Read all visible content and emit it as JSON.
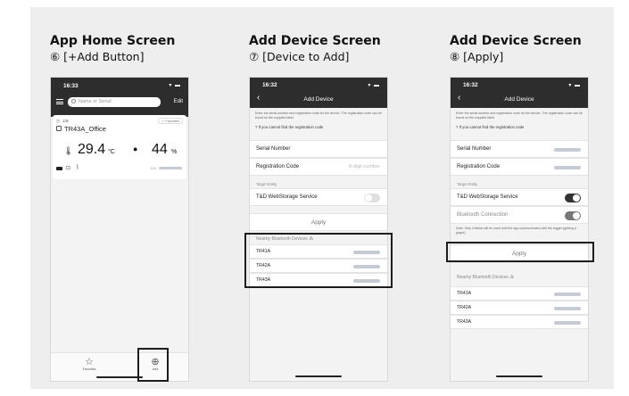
{
  "columns": [
    {
      "title": "App Home Screen",
      "subtitle": "⑥ [+Add Button]"
    },
    {
      "title": "Add Device Screen",
      "subtitle": "⑦ [Device to Add]"
    },
    {
      "title": "Add Device Screen",
      "subtitle": "⑧ [Apply]"
    }
  ],
  "home": {
    "time": "16:33",
    "search_placeholder": "Name or Serial",
    "edit": "Edit",
    "card": {
      "age": "13s",
      "favorites": "Favorites",
      "name": "TR43A_Office",
      "temp_value": "29.4",
      "temp_unit": "°C",
      "hum_value": "44",
      "hum_unit": "%",
      "signal": "12h"
    },
    "tab_favorites": "Favorites",
    "tab_add": "Add"
  },
  "add7": {
    "time": "16:32",
    "title": "Add Device",
    "intro": "Enter the serial number and registration code for the device. The registration code can be found on the supplied label.",
    "help": "If you cannot find the registration code",
    "serial_label": "Serial Number",
    "regcode_label": "Registration Code",
    "regcode_placeholder": "8-digit number",
    "target_section": "Target Entity",
    "webstorage_label": "T&D WebStorage Service",
    "apply": "Apply",
    "nearby_label": "Nearby Bluetooth Devices",
    "devices": [
      "TR41A",
      "TR42A",
      "TR43A"
    ]
  },
  "add8": {
    "time": "16:32",
    "title": "Add Device",
    "intro": "Enter the serial number and registration code for the device. The registration code can be found on the supplied label.",
    "help": "If you cannot find the registration code",
    "serial_label": "Serial Number",
    "regcode_label": "Registration Code",
    "target_section": "Target Entity",
    "webstorage_label": "T&D WebStorage Service",
    "bluetooth_label": "Bluetooth Connection",
    "note": "Note: Only Cellular will be used until the app communicates with the logger (getting a graph).",
    "apply": "Apply",
    "nearby_label": "Nearby Bluetooth Devices",
    "devices": [
      "TR41A",
      "TR42A",
      "TR43A"
    ]
  },
  "colors": {
    "accent_blue": "#1a4fa0",
    "toggle_on": "#333333",
    "toggle_off": "#dcdcdc"
  },
  "icons": [
    "menu-icon",
    "search-icon",
    "clock-icon",
    "logger-icon",
    "thermometer-icon",
    "droplet-icon",
    "battery-icon",
    "lock-icon",
    "bluetooth-icon",
    "star-icon",
    "add-circle-icon",
    "help-icon",
    "spinner-icon",
    "back-icon",
    "wifi-icon"
  ]
}
